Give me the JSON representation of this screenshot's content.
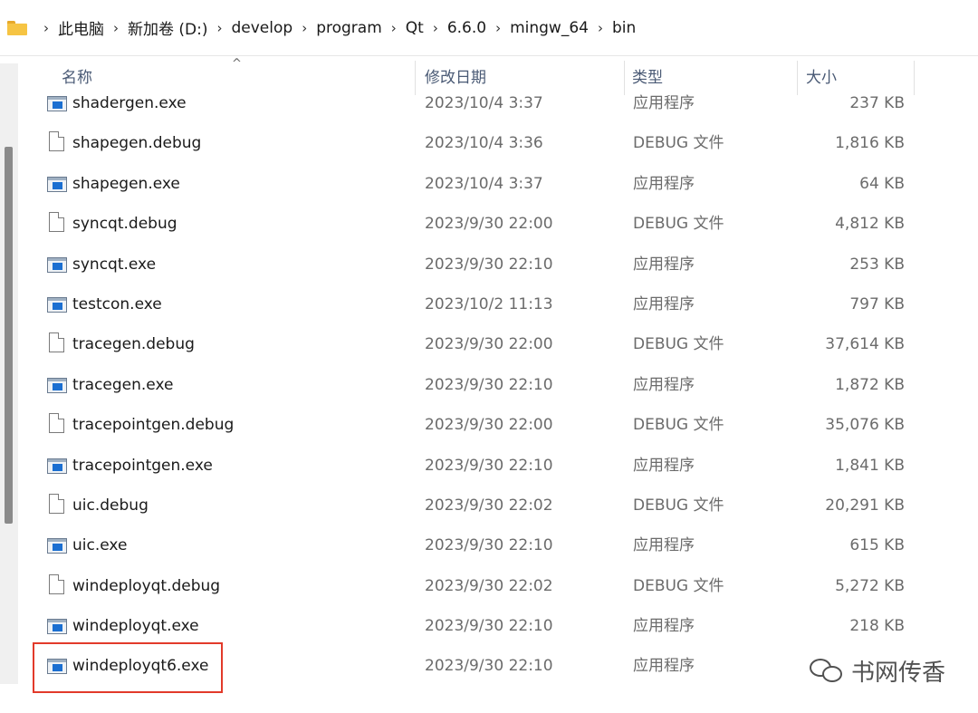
{
  "breadcrumb": [
    "此电脑",
    "新加卷 (D:)",
    "develop",
    "program",
    "Qt",
    "6.6.0",
    "mingw_64",
    "bin"
  ],
  "columns": {
    "name": "名称",
    "date": "修改日期",
    "type": "类型",
    "size": "大小"
  },
  "files": [
    {
      "name": "shadergen.exe",
      "date": "2023/10/4 3:37",
      "type": "应用程序",
      "size": "237 KB",
      "icon": "exe-icon"
    },
    {
      "name": "shapegen.debug",
      "date": "2023/10/4 3:36",
      "type": "DEBUG 文件",
      "size": "1,816 KB",
      "icon": "file-icon"
    },
    {
      "name": "shapegen.exe",
      "date": "2023/10/4 3:37",
      "type": "应用程序",
      "size": "64 KB",
      "icon": "exe-icon"
    },
    {
      "name": "syncqt.debug",
      "date": "2023/9/30 22:00",
      "type": "DEBUG 文件",
      "size": "4,812 KB",
      "icon": "file-icon"
    },
    {
      "name": "syncqt.exe",
      "date": "2023/9/30 22:10",
      "type": "应用程序",
      "size": "253 KB",
      "icon": "exe-icon"
    },
    {
      "name": "testcon.exe",
      "date": "2023/10/2 11:13",
      "type": "应用程序",
      "size": "797 KB",
      "icon": "exe-icon"
    },
    {
      "name": "tracegen.debug",
      "date": "2023/9/30 22:00",
      "type": "DEBUG 文件",
      "size": "37,614 KB",
      "icon": "file-icon"
    },
    {
      "name": "tracegen.exe",
      "date": "2023/9/30 22:10",
      "type": "应用程序",
      "size": "1,872 KB",
      "icon": "exe-icon"
    },
    {
      "name": "tracepointgen.debug",
      "date": "2023/9/30 22:00",
      "type": "DEBUG 文件",
      "size": "35,076 KB",
      "icon": "file-icon"
    },
    {
      "name": "tracepointgen.exe",
      "date": "2023/9/30 22:10",
      "type": "应用程序",
      "size": "1,841 KB",
      "icon": "exe-icon"
    },
    {
      "name": "uic.debug",
      "date": "2023/9/30 22:02",
      "type": "DEBUG 文件",
      "size": "20,291 KB",
      "icon": "file-icon"
    },
    {
      "name": "uic.exe",
      "date": "2023/9/30 22:10",
      "type": "应用程序",
      "size": "615 KB",
      "icon": "exe-icon"
    },
    {
      "name": "windeployqt.debug",
      "date": "2023/9/30 22:02",
      "type": "DEBUG 文件",
      "size": "5,272 KB",
      "icon": "file-icon"
    },
    {
      "name": "windeployqt.exe",
      "date": "2023/9/30 22:10",
      "type": "应用程序",
      "size": "218 KB",
      "icon": "exe-icon"
    },
    {
      "name": "windeployqt6.exe",
      "date": "2023/9/30 22:10",
      "type": "应用程序",
      "size": "",
      "icon": "exe-icon"
    }
  ],
  "watermark": "书网传香",
  "colors": {
    "highlight": "#e23a2a",
    "header_text": "#4a5a75",
    "folder": "#f6c443",
    "exe_blue": "#1b6fd1"
  }
}
